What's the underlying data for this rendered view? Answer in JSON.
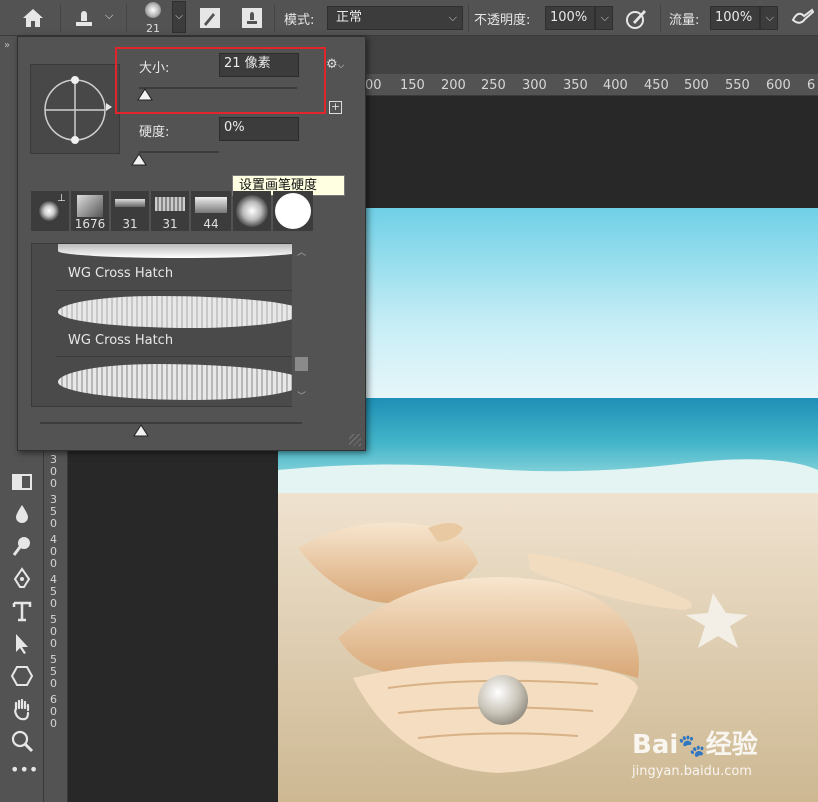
{
  "options_bar": {
    "brush_size_preview": "21",
    "mode_label": "模式:",
    "mode_value": "正常",
    "opacity_label": "不透明度:",
    "opacity_value": "100%",
    "flow_label": "流量:",
    "flow_value": "100%"
  },
  "ruler": {
    "h_ticks": [
      "00",
      "150",
      "200",
      "250",
      "300",
      "350",
      "400",
      "450",
      "500",
      "550",
      "600",
      "6"
    ],
    "v_ticks": [
      "3",
      "0",
      "0",
      "3",
      "5",
      "0",
      "4",
      "0",
      "0",
      "4",
      "5",
      "0",
      "5",
      "0",
      "0",
      "5",
      "5",
      "0",
      "6",
      "0",
      "0"
    ]
  },
  "brush_panel": {
    "size_label": "大小:",
    "size_value": "21 像素",
    "size_level": 0.04,
    "hardness_label": "硬度:",
    "hardness_value": "0%",
    "hardness_level": 0.0,
    "tooltip": "设置画笔硬度",
    "presets": [
      {
        "label": ""
      },
      {
        "label": "1676"
      },
      {
        "label": "31"
      },
      {
        "label": "31"
      },
      {
        "label": "44"
      },
      {
        "label": ""
      },
      {
        "label": ""
      }
    ],
    "brush_list": [
      {
        "name": "WG Cross Hatch"
      },
      {
        "name": "WG Cross Hatch"
      }
    ]
  },
  "watermark": {
    "brand": "Bai",
    "brand2": "经验",
    "url": "jingyan.baidu.com"
  }
}
